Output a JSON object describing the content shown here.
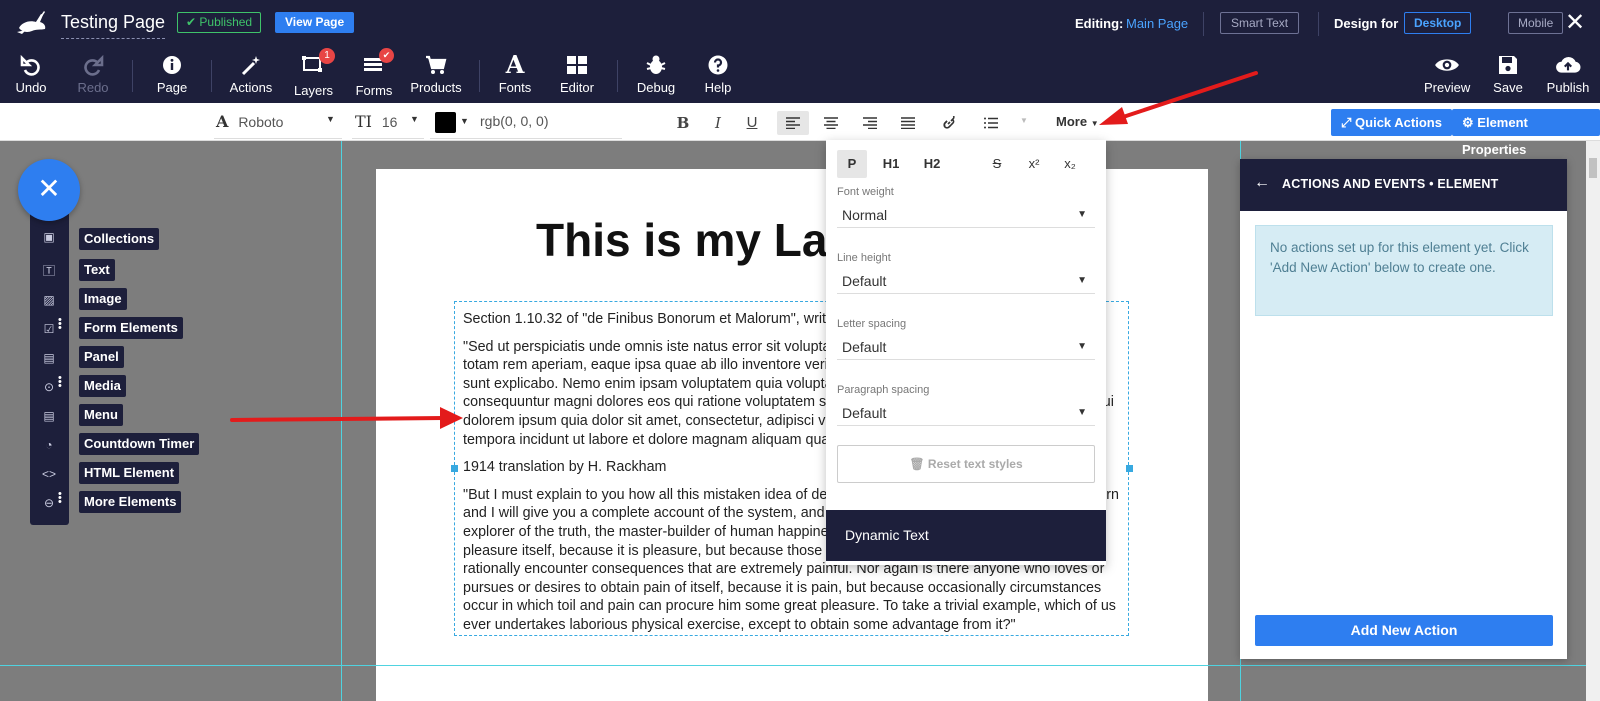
{
  "header": {
    "page_title": "Testing Page",
    "published_label": "✔ Published",
    "view_page_label": "View Page",
    "editing_label": "Editing:",
    "editing_page": "Main Page",
    "smart_text_label": "Smart Text",
    "design_for_label": "Design for",
    "desktop_label": "Desktop",
    "mobile_label": "Mobile"
  },
  "toolbar": {
    "undo": "Undo",
    "redo": "Redo",
    "page": "Page",
    "actions": "Actions",
    "layers": "Layers",
    "layers_badge": "1",
    "forms": "Forms",
    "products": "Products",
    "fonts": "Fonts",
    "editor": "Editor",
    "debug": "Debug",
    "help": "Help",
    "preview": "Preview",
    "save": "Save",
    "publish": "Publish"
  },
  "format": {
    "font_family": "Roboto",
    "font_size": "16",
    "color_value": "rgb(0, 0, 0)",
    "color_swatch": "#000000",
    "more_label": "More",
    "quick_actions": "Quick Actions",
    "element_properties": "Element Properties"
  },
  "canvas": {
    "heading": "This is my Lan",
    "paragraphs": [
      "Section 1.10.32 of \"de Finibus Bonorum et Malorum\", written by Cicero in 45 BC",
      "\"Sed ut perspiciatis unde omnis iste natus error sit voluptatem accusantium doloremque laudantium, totam rem aperiam, eaque ipsa quae ab illo inventore veritatis et quasi architecto beatae vitae dicta sunt explicabo. Nemo enim ipsam voluptatem quia voluptas sit aspernatur aut odit aut fugit, sed quia consequuntur magni dolores eos qui ratione voluptatem sequi nesciunt. Neque porro quisquam est, qui dolorem ipsum quia dolor sit amet, consectetur, adipisci velit, sed quia non numquam eius modi tempora incidunt ut labore et dolore magnam aliquam quaerat voluptatem.\"",
      "1914 translation by H. Rackham",
      "\"But I must explain to you how all this mistaken idea of denouncing pleasure and praising pain was born and I will give you a complete account of the system, and expound the actual teachings of the great explorer of the truth, the master-builder of human happiness. No one rejects, dislikes, or avoids pleasure itself, because it is pleasure, but because those who do not know how to pursue pleasure rationally encounter consequences that are extremely painful. Nor again is there anyone who loves or pursues or desires to obtain pain of itself, because it is pain, but because occasionally circumstances occur in which toil and pain can procure him some great pleasure. To take a trivial example, which of us ever undertakes laborious physical exercise, except to obtain some advantage from it?\""
    ]
  },
  "sidebar": {
    "items": [
      {
        "label": "Collections",
        "icon": "collections-icon"
      },
      {
        "label": "Text",
        "icon": "text-icon"
      },
      {
        "label": "Image",
        "icon": "image-icon"
      },
      {
        "label": "Form Elements",
        "icon": "form-icon"
      },
      {
        "label": "Panel",
        "icon": "panel-icon"
      },
      {
        "label": "Media",
        "icon": "media-icon"
      },
      {
        "label": "Menu",
        "icon": "menu-icon"
      },
      {
        "label": "Countdown Timer",
        "icon": "timer-icon"
      },
      {
        "label": "HTML Element",
        "icon": "code-icon"
      },
      {
        "label": "More Elements",
        "icon": "more-icon"
      }
    ]
  },
  "dropdown": {
    "p_label": "P",
    "h1_label": "H1",
    "h2_label": "H2",
    "strike_label": "S",
    "sup_label": "x²",
    "sub_label": "x₂",
    "font_weight_label": "Font weight",
    "font_weight_value": "Normal",
    "line_height_label": "Line height",
    "line_height_value": "Default",
    "letter_spacing_label": "Letter spacing",
    "letter_spacing_value": "Default",
    "paragraph_spacing_label": "Paragraph spacing",
    "paragraph_spacing_value": "Default",
    "reset_label": "Reset text styles",
    "dynamic_text_label": "Dynamic Text"
  },
  "panel": {
    "title": "ACTIONS AND EVENTS • ELEMENT",
    "info": "No actions set up for this element yet. Click 'Add New Action' below to create one.",
    "add_button": "Add New Action"
  },
  "colors": {
    "navy": "#1d1f3b",
    "accent": "#2e7ef0",
    "annotation_arrow": "#e31b1b"
  }
}
